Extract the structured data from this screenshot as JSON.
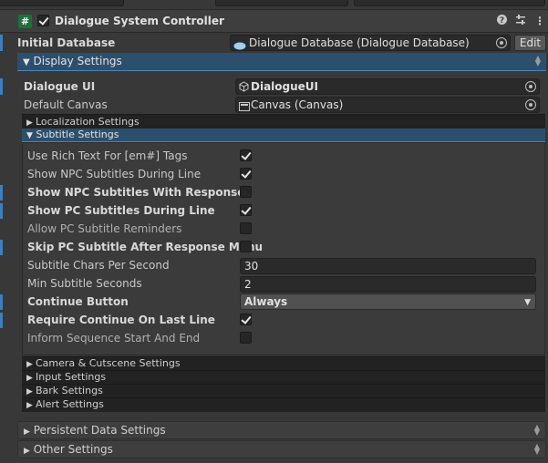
{
  "component": {
    "title": "Dialogue System Controller",
    "enabled": true,
    "icons": {
      "help": "help-icon",
      "presets": "presets-icon",
      "menu": "kebab-menu-icon"
    }
  },
  "initial_database": {
    "label": "Initial Database",
    "value": "Dialogue Database (Dialogue Database)",
    "edit": "Edit"
  },
  "display_settings": {
    "label": "Display Settings",
    "dialogue_ui": {
      "label": "Dialogue UI",
      "value": "DialogueUI"
    },
    "default_canvas": {
      "label": "Default Canvas",
      "value": "Canvas (Canvas)"
    },
    "localization": "Localization Settings",
    "subtitle": {
      "label": "Subtitle Settings",
      "rows": [
        {
          "label": "Use Rich Text For [em#] Tags",
          "checked": true
        },
        {
          "label": "Show NPC Subtitles During Line",
          "checked": true
        },
        {
          "label": "Show NPC Subtitles With Responses",
          "checked": false
        },
        {
          "label": "Show PC Subtitles During Line",
          "checked": true
        },
        {
          "label": "Allow PC Subtitle Reminders",
          "checked": false
        },
        {
          "label": "Skip PC Subtitle After Response Menu",
          "checked": false
        },
        {
          "label": "Subtitle Chars Per Second",
          "value": "30"
        },
        {
          "label": "Min Subtitle Seconds",
          "value": "2"
        },
        {
          "label": "Continue Button",
          "value": "Always"
        },
        {
          "label": "Require Continue On Last Line",
          "checked": true
        },
        {
          "label": "Inform Sequence Start And End",
          "checked": false
        }
      ]
    },
    "camera": "Camera & Cutscene Settings",
    "input": "Input Settings",
    "bark": "Bark Settings",
    "alert": "Alert Settings"
  },
  "persistent": "Persistent Data Settings",
  "other": "Other Settings",
  "colors": {
    "accent": "#3d7fc0",
    "section": "#2c4f6d"
  }
}
